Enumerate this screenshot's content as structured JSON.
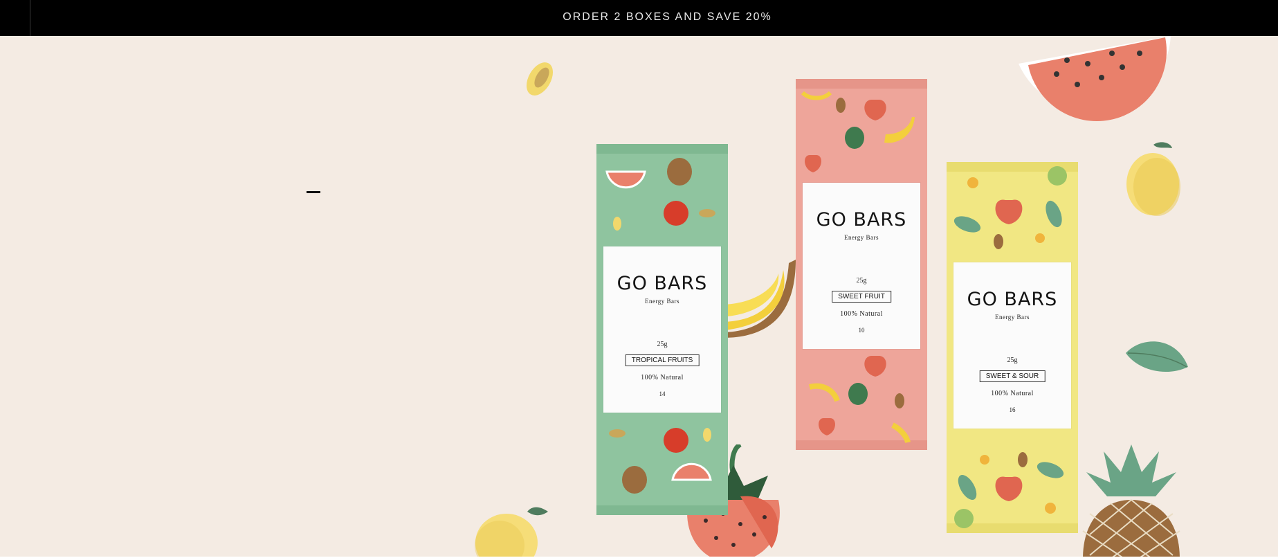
{
  "promo": {
    "text": "ORDER 2 BOXES AND SAVE 20%"
  },
  "products": [
    {
      "brand": "GO BARS",
      "subtitle": "Energy Bars",
      "weight": "25g",
      "flavor": "TROPICAL FRUITS",
      "natural": "100% Natural",
      "number": "14",
      "color": "#8fc49f"
    },
    {
      "brand": "GO BARS",
      "subtitle": "Energy Bars",
      "weight": "25g",
      "flavor": "SWEET FRUIT",
      "natural": "100% Natural",
      "number": "10",
      "color": "#eea59a"
    },
    {
      "brand": "GO BARS",
      "subtitle": "Energy Bars",
      "weight": "25g",
      "flavor": "SWEET & SOUR",
      "natural": "100% Natural",
      "number": "16",
      "color": "#f1e783"
    }
  ],
  "colors": {
    "hero_bg": "#f4ebe3",
    "watermelon": "#e9806b",
    "lemon": "#f6dd78",
    "leaf": "#6aa486",
    "banana": "#f3cf3c",
    "pineapple": "#9b6c3e"
  }
}
